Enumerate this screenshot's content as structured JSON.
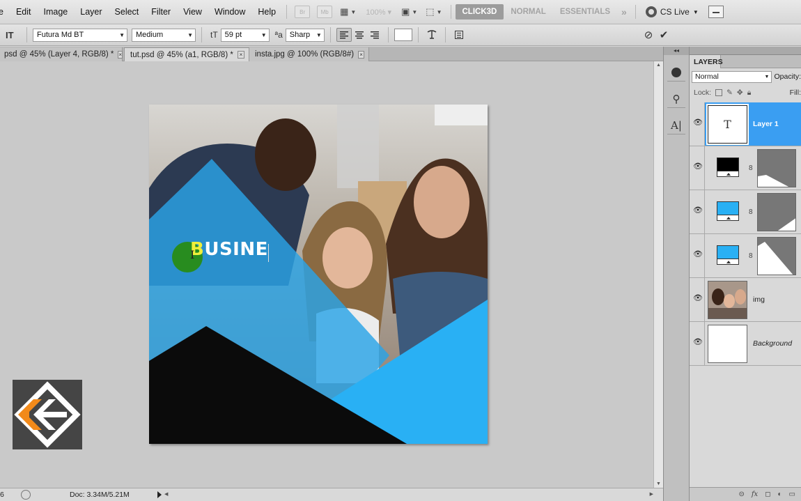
{
  "menu": {
    "items": [
      "e",
      "Edit",
      "Image",
      "Layer",
      "Select",
      "Filter",
      "View",
      "Window",
      "Help"
    ],
    "bridge_label": "Br",
    "minibridge_label": "Mb",
    "zoom": "100%",
    "workspaces": {
      "click3d": "CLICK3D",
      "normal": "NORMAL",
      "essentials": "ESSENTIALS",
      "more": "»"
    },
    "cs_live": "CS Live"
  },
  "options": {
    "tool_icon": "IT",
    "font_family": "Futura Md BT",
    "font_style": "Medium",
    "size_icon": "tT",
    "font_size": "59 pt",
    "aa_icon": "ªa",
    "antialias": "Sharp",
    "cancel_icon": "⊘",
    "commit_icon": "✔",
    "colors": {
      "text_color": "#ffffff"
    }
  },
  "tabs": [
    {
      "label": "psd @ 45% (Layer 4, RGB/8) *",
      "close": "×"
    },
    {
      "label": "tut.psd @ 45% (a1, RGB/8) *",
      "close": "×"
    },
    {
      "label": "insta.jpg @ 100% (RGB/8#)",
      "close": "×"
    }
  ],
  "canvas": {
    "text_first": "B",
    "text_rest": "USINE",
    "colors": {
      "blue": "#29b0f4",
      "dark": "#0b0b0b",
      "highlight": "#f0ef3a"
    }
  },
  "status": {
    "zoom": "6",
    "doc": "Doc: 3.34M/5.21M"
  },
  "layers_panel": {
    "tab_label": "LAYERS",
    "blend_mode": "Normal",
    "opacity_label": "Opacity:",
    "lock_label": "Lock:",
    "fill_label": "Fill:",
    "layers": [
      {
        "name": "Layer 1",
        "kind": "type",
        "thumb_text": "T"
      },
      {
        "name": "",
        "kind": "fill",
        "color": "#000000"
      },
      {
        "name": "",
        "kind": "fill",
        "color": "#29b0f4"
      },
      {
        "name": "",
        "kind": "fill",
        "color": "#29b0f4"
      },
      {
        "name": "img",
        "kind": "image"
      },
      {
        "name": "Background",
        "kind": "background"
      }
    ]
  }
}
